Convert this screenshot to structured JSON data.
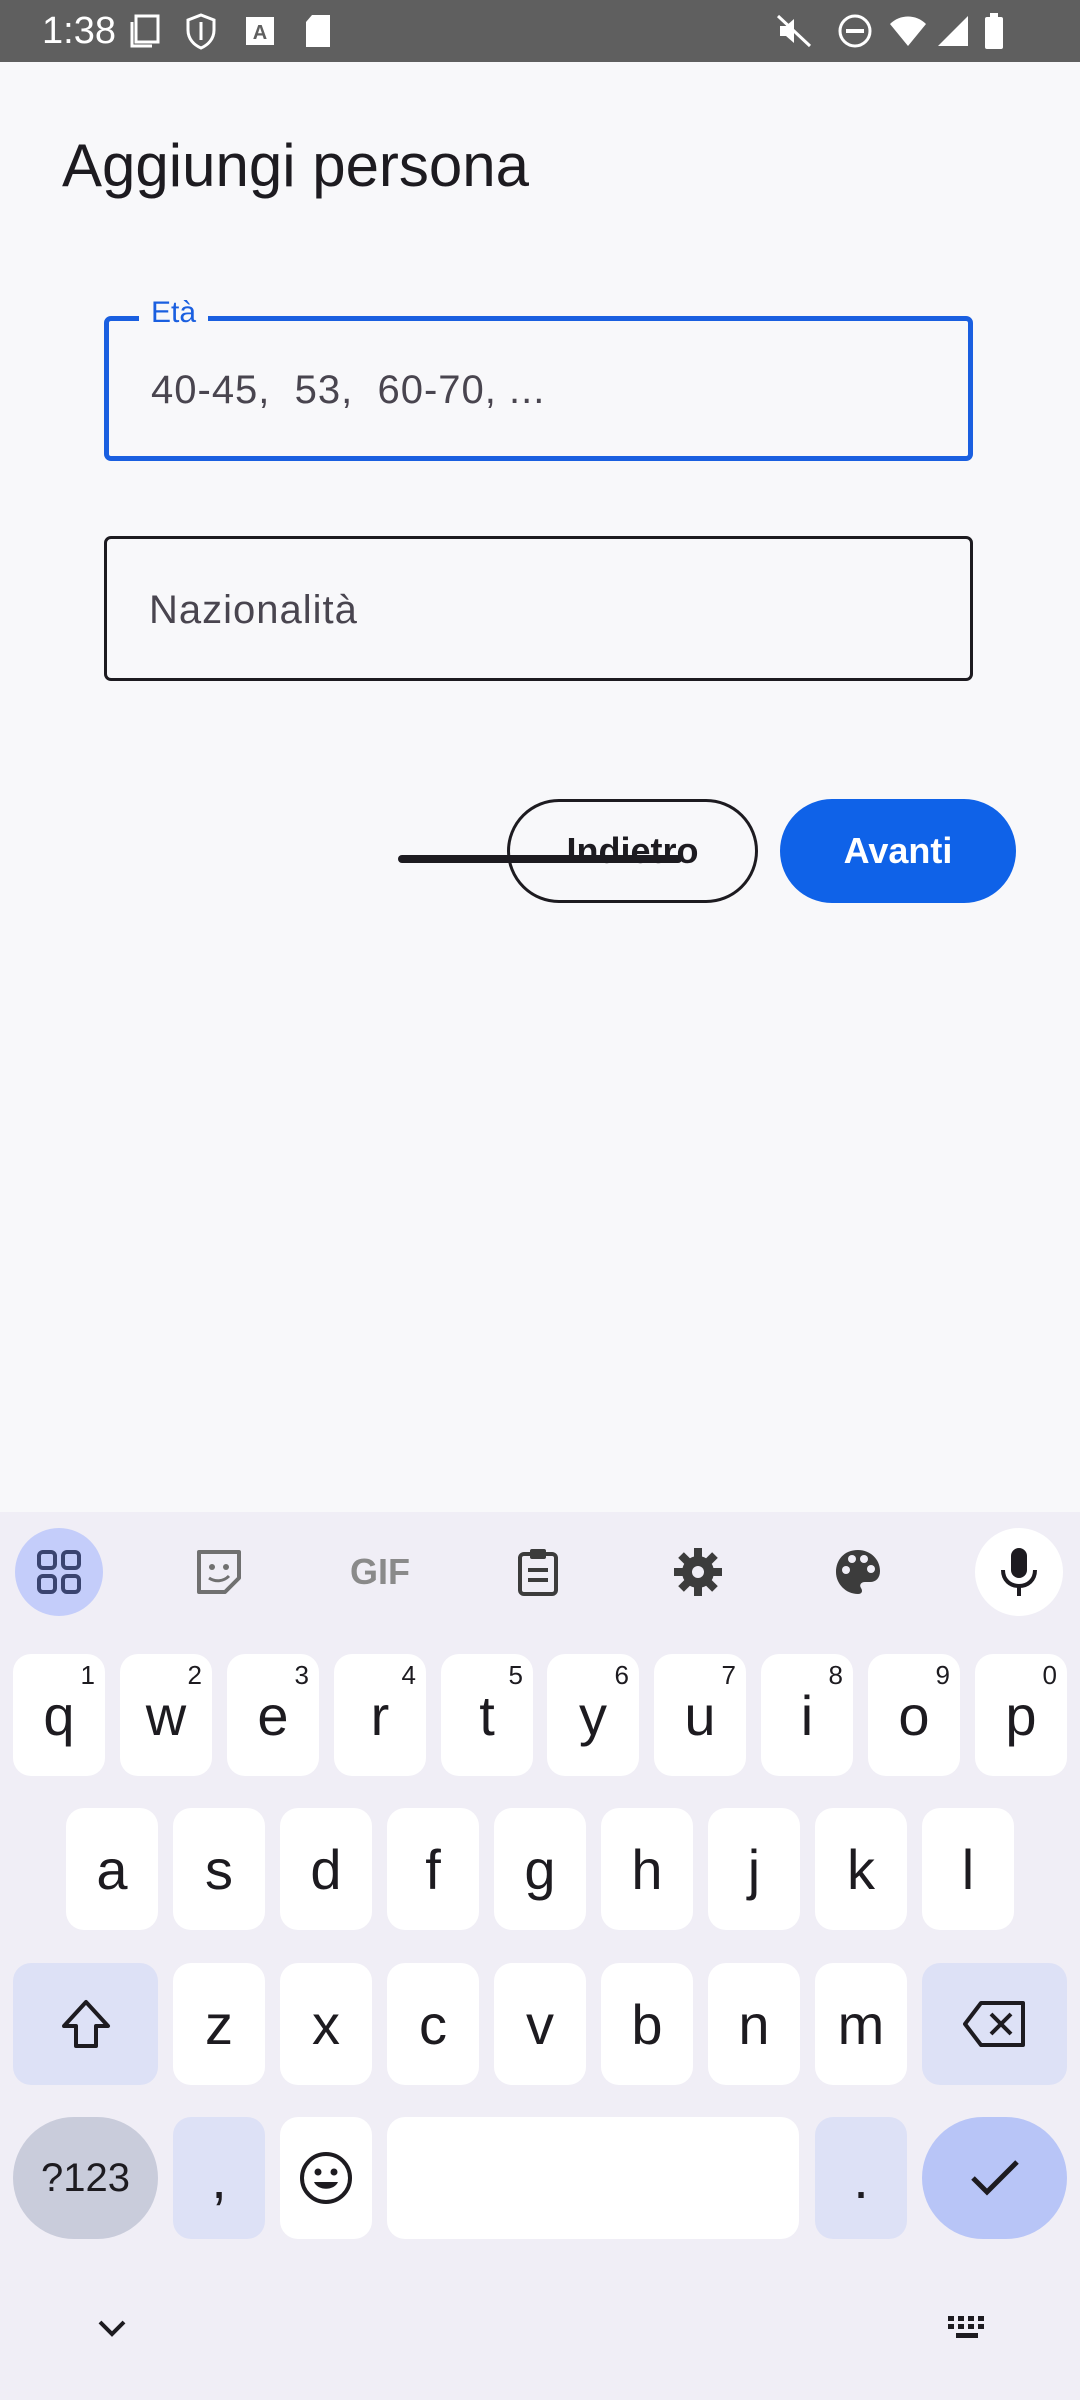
{
  "status_bar": {
    "time": "1:38",
    "icons": [
      "screenshot-icon",
      "shield-icon",
      "font-a-icon",
      "sd-card-icon",
      "mute-icon",
      "dnd-icon",
      "wifi-icon",
      "signal-icon",
      "battery-icon"
    ]
  },
  "page": {
    "title": "Aggiungi persona"
  },
  "fields": {
    "age": {
      "label": "Età",
      "placeholder": "40-45,  53,  60-70, ..."
    },
    "nationality": {
      "placeholder": "Nazionalità"
    }
  },
  "buttons": {
    "back": "Indietro",
    "next": "Avanti"
  },
  "colors": {
    "accent": "#0f62e8",
    "focus_border": "#1a5fe0",
    "keyboard_bg": "#f0eef6"
  },
  "keyboard": {
    "toolbar": [
      "apps-grid-icon",
      "sticker-icon",
      "gif-icon",
      "clipboard-icon",
      "settings-icon",
      "palette-icon",
      "mic-icon"
    ],
    "gif_label": "GIF",
    "row1": [
      {
        "k": "q",
        "h": "1"
      },
      {
        "k": "w",
        "h": "2"
      },
      {
        "k": "e",
        "h": "3"
      },
      {
        "k": "r",
        "h": "4"
      },
      {
        "k": "t",
        "h": "5"
      },
      {
        "k": "y",
        "h": "6"
      },
      {
        "k": "u",
        "h": "7"
      },
      {
        "k": "i",
        "h": "8"
      },
      {
        "k": "o",
        "h": "9"
      },
      {
        "k": "p",
        "h": "0"
      }
    ],
    "row2": [
      "a",
      "s",
      "d",
      "f",
      "g",
      "h",
      "j",
      "k",
      "l"
    ],
    "row3": [
      "z",
      "x",
      "c",
      "v",
      "b",
      "n",
      "m"
    ],
    "symbols_label": "?123",
    "comma": ",",
    "period": "."
  }
}
